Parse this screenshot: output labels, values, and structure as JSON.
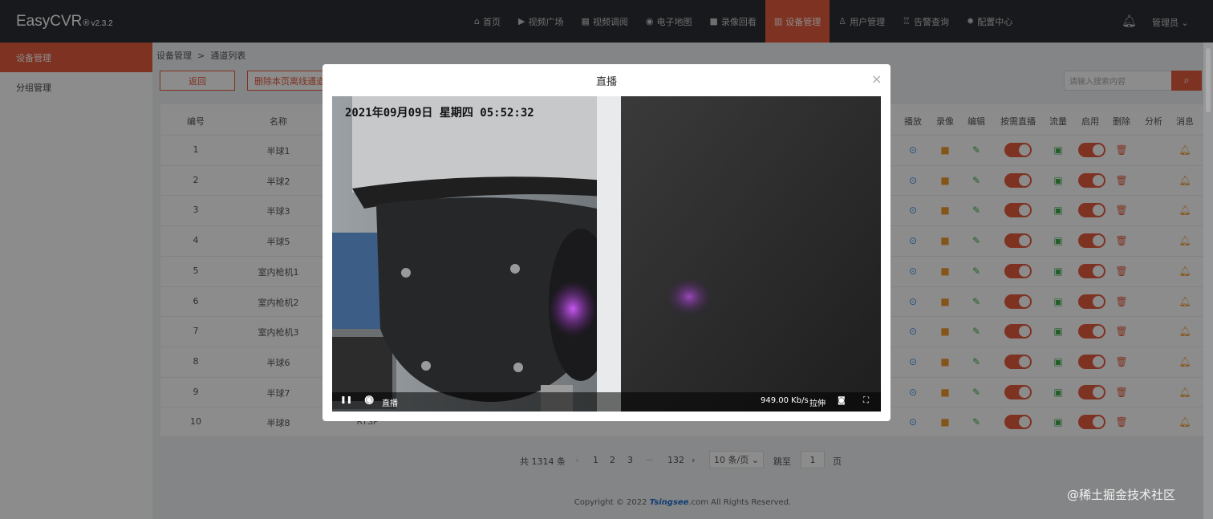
{
  "app": {
    "name": "EasyCVR",
    "reg": "®",
    "version": "v2.3.2"
  },
  "nav": [
    {
      "icon": "home-icon",
      "glyph": "⌂",
      "label": "首页"
    },
    {
      "icon": "play-circle-icon",
      "glyph": "▶",
      "label": "视频广场"
    },
    {
      "icon": "monitor-icon",
      "glyph": "▦",
      "label": "视频调阅"
    },
    {
      "icon": "map-pin-icon",
      "glyph": "◉",
      "label": "电子地图"
    },
    {
      "icon": "video-camera-icon",
      "glyph": "■",
      "label": "录像回看"
    },
    {
      "icon": "devices-icon",
      "glyph": "▥",
      "label": "设备管理"
    },
    {
      "icon": "user-icon",
      "glyph": "♙",
      "label": "用户管理"
    },
    {
      "icon": "alarm-icon",
      "glyph": "♖",
      "label": "告警查询"
    },
    {
      "icon": "gear-icon",
      "glyph": "✹",
      "label": "配置中心"
    }
  ],
  "nav_active": 5,
  "user": {
    "label": "管理员",
    "chevron": "⌄"
  },
  "sidebar": [
    {
      "label": "设备管理",
      "active": true
    },
    {
      "label": "分组管理",
      "active": false
    }
  ],
  "breadcrumb": {
    "root": "设备管理",
    "sep": ">",
    "current": "通道列表"
  },
  "toolbar": {
    "back": "返回",
    "delete_offline": "删除本页离线通道",
    "search_placeholder": "请输入搜索内容",
    "search_glyph": "⌕"
  },
  "table": {
    "headers": {
      "id": "编号",
      "name": "名称",
      "play": "播放",
      "record": "录像",
      "edit": "编辑",
      "on_demand": "按需直播",
      "flow": "流量",
      "enable": "启用",
      "delete": "删除",
      "analyze": "分析",
      "message": "消息"
    },
    "rows": [
      {
        "id": "1",
        "name": "半球1"
      },
      {
        "id": "2",
        "name": "半球2"
      },
      {
        "id": "3",
        "name": "半球3"
      },
      {
        "id": "4",
        "name": "半球5"
      },
      {
        "id": "5",
        "name": "室内枪机1"
      },
      {
        "id": "6",
        "name": "室内枪机2"
      },
      {
        "id": "7",
        "name": "室内枪机3"
      },
      {
        "id": "8",
        "name": "半球6"
      },
      {
        "id": "9",
        "name": "半球7"
      },
      {
        "id": "10",
        "name": "半球8"
      }
    ],
    "partial_text": "RTSP"
  },
  "pager": {
    "total": "共 1314 条",
    "prev": "‹",
    "pages": [
      "1",
      "2",
      "3"
    ],
    "ellipsis": "···",
    "last": "132",
    "next": "›",
    "page_size": "10 条/页",
    "page_size_chevron": "⌄",
    "jump_label": "跳至",
    "jump_value": "1",
    "jump_suffix": "页"
  },
  "footer": {
    "pre": "Copyright © 2022 ",
    "brand": "Tsingsee",
    "post": ".com All Rights Reserved."
  },
  "modal": {
    "title": "直播",
    "close": "×",
    "osd": "2021年09月09日 星期四 05:52:32",
    "controls": {
      "pause": "❚❚",
      "mute": "🔇",
      "live": "直播",
      "bitrate": "949.00 Kb/s",
      "stretch": "拉伸",
      "snapshot": "◙",
      "fullscreen": "⛶"
    }
  },
  "watermark": "@稀土掘金技术社区"
}
